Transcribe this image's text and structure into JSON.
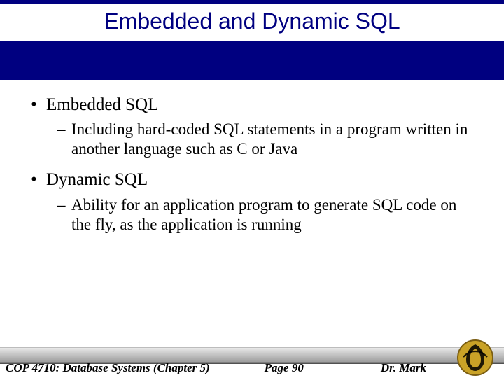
{
  "colors": {
    "navy": "#000080",
    "gold": "#c9a227",
    "footer_gray_top": "#e8e8e8",
    "footer_gray_bottom": "#9a9a9a"
  },
  "title": "Embedded and Dynamic SQL",
  "bullets": [
    {
      "text": "Embedded SQL",
      "sub": [
        "Including hard-coded SQL statements in a program written in another language such as C or Java"
      ]
    },
    {
      "text": "Dynamic SQL",
      "sub": [
        "Ability for an application program to generate SQL code on the fly, as the application is running"
      ]
    }
  ],
  "footer": {
    "course": "COP 4710: Database Systems (Chapter 5)",
    "page": "Page 90",
    "author": "Dr. Mark"
  },
  "logo_name": "ucf-pegasus-logo"
}
